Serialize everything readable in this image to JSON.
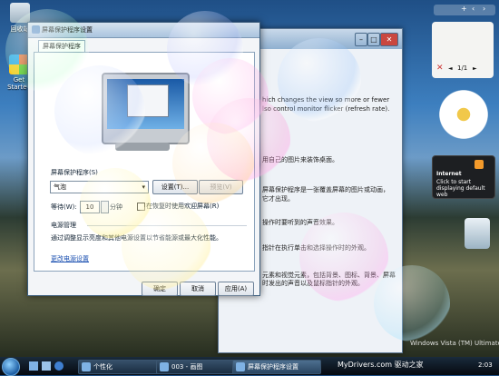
{
  "desktop": {
    "icons": [
      {
        "label": "回收站",
        "icon": "recycle-bin-icon"
      },
      {
        "label": "Get Started",
        "icon": "windows-logo-icon"
      }
    ]
  },
  "personalize_window": {
    "lines": [
      "hich changes the view so more or fewer",
      "lso control monitor flicker (refresh rate).",
      "用自己的图片来装饰桌面。",
      "屏幕保护程序是一张覆盖屏幕的图片或动画，",
      "它才出现。",
      "操作时要听到的声音效果。",
      "指针在执行单击和选择操作时的外观。",
      "元素和视觉元素，包括背景、图标、背景、屏幕",
      "时发出的声音以及鼠标指针的外观。"
    ]
  },
  "dialog": {
    "title": "屏幕保护程序设置",
    "tab": "屏幕保护程序",
    "screensaver_label": "屏幕保护程序(S)",
    "screensaver_value": "气泡",
    "settings_button": "设置(T)...",
    "preview_button": "预览(V)",
    "wait_label": "等待(W):",
    "wait_value": "10",
    "minutes_label": "分钟",
    "resume_checkbox": "在恢复时使用欢迎屏幕(R)",
    "power_heading": "电源管理",
    "power_text": "通过调整显示亮度和其他电源设置以节省能源或最大化性能。",
    "power_link": "更改电源设置",
    "ok_button": "确定",
    "cancel_button": "取消",
    "apply_button": "应用(A)"
  },
  "sidebar": {
    "slideshow_counter": "1/1",
    "feed_title": "Internet",
    "feed_text": "Click to start displaying default web"
  },
  "watermark": "Windows Vista (TM) Ultimate",
  "taskbar": {
    "tasks": [
      "个性化",
      "003 - 画图",
      "屏幕保护程序设置"
    ],
    "brand": "MyDrivers.com 驱动之家",
    "clock": "2:03"
  }
}
